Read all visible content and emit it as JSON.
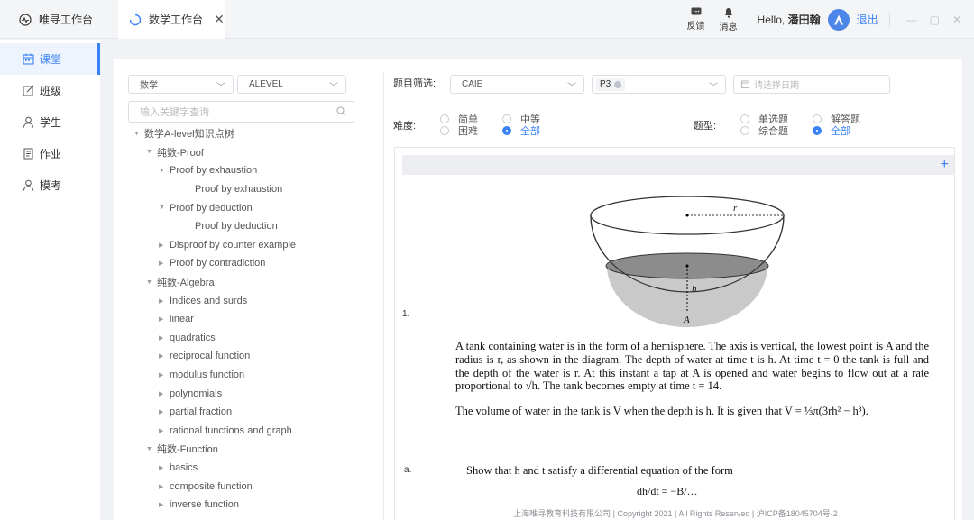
{
  "topbar": {
    "home_tab": "唯寻工作台",
    "active_tab": "数学工作台",
    "close_glyph": "✕",
    "feedback": "反馈",
    "messages": "消息",
    "hello": "Hello, ",
    "username": "潘田翰",
    "logout": "退出",
    "win_minimize": "—",
    "win_maximize": "▢",
    "win_close": "✕"
  },
  "sidebar": {
    "items": [
      {
        "label": "课堂",
        "icon": "calendar-icon",
        "active": true
      },
      {
        "label": "班级",
        "icon": "edit-icon",
        "active": false
      },
      {
        "label": "学生",
        "icon": "user-icon",
        "active": false
      },
      {
        "label": "作业",
        "icon": "document-icon",
        "active": false
      },
      {
        "label": "模考",
        "icon": "user-icon",
        "active": false
      }
    ]
  },
  "left_panel": {
    "subject_select": "数学",
    "level_select": "ALEVEL",
    "search_placeholder": "输入关键字查询",
    "tree": [
      {
        "label": "数学A-level知识点树",
        "level": 0,
        "expanded": true
      },
      {
        "label": "纯数-Proof",
        "level": 1,
        "expanded": true
      },
      {
        "label": "Proof by exhaustion",
        "level": 2,
        "expanded": true
      },
      {
        "label": "Proof by exhaustion",
        "level": 3,
        "expanded": null
      },
      {
        "label": "Proof by deduction",
        "level": 2,
        "expanded": true
      },
      {
        "label": "Proof by deduction",
        "level": 3,
        "expanded": null
      },
      {
        "label": "Disproof by counter example",
        "level": 2,
        "expanded": false
      },
      {
        "label": "Proof by contradiction",
        "level": 2,
        "expanded": false
      },
      {
        "label": "纯数-Algebra",
        "level": 1,
        "expanded": true
      },
      {
        "label": "Indices and surds",
        "level": 2,
        "expanded": false
      },
      {
        "label": "linear",
        "level": 2,
        "expanded": false
      },
      {
        "label": "quadratics",
        "level": 2,
        "expanded": false
      },
      {
        "label": "reciprocal function",
        "level": 2,
        "expanded": false
      },
      {
        "label": "modulus function",
        "level": 2,
        "expanded": false
      },
      {
        "label": "polynomials",
        "level": 2,
        "expanded": false
      },
      {
        "label": "partial fraction",
        "level": 2,
        "expanded": false
      },
      {
        "label": "rational functions and graph",
        "level": 2,
        "expanded": false
      },
      {
        "label": "纯数-Function",
        "level": 1,
        "expanded": true
      },
      {
        "label": "basics",
        "level": 2,
        "expanded": false
      },
      {
        "label": "composite function",
        "level": 2,
        "expanded": false
      },
      {
        "label": "inverse function",
        "level": 2,
        "expanded": false
      }
    ]
  },
  "filter": {
    "label": "题目筛选:",
    "board_select": "CAIE",
    "paper_chip": "P3",
    "date_placeholder": "请选择日期",
    "difficulty_label": "难度:",
    "difficulty_options": [
      {
        "label": "简单",
        "selected": false
      },
      {
        "label": "中等",
        "selected": false
      },
      {
        "label": "困难",
        "selected": false
      },
      {
        "label": "全部",
        "selected": true
      }
    ],
    "type_label": "题型:",
    "type_options": [
      {
        "label": "单选题",
        "selected": false
      },
      {
        "label": "解答题",
        "selected": false
      },
      {
        "label": "综合题",
        "selected": false
      },
      {
        "label": "全部",
        "selected": true
      }
    ]
  },
  "question": {
    "add_glyph": "+",
    "number": "1.",
    "diagram_labels": {
      "r": "r",
      "h": "h",
      "A": "A"
    },
    "para1": "A tank containing water is in the form of a hemisphere. The axis is vertical, the lowest point is A and the radius is r, as shown in the diagram. The depth of water at time t is h. At time t = 0 the tank is full and the depth of the water is r. At this instant a tap at A is opened and water begins to flow out at a rate proportional to √h. The tank becomes empty at time t = 14.",
    "para2": "The volume of water in the tank is V when the depth is h. It is given that V = ⅓π(3rh² − h³).",
    "part_label": "a.",
    "part_text": "Show that h and t satisfy a differential equation of the form",
    "equation": "dh/dt = −B/…",
    "footer": "上海唯寻教育科技有限公司 | Copyright 2021 | All Rights Reserved | 沪ICP备18045704号-2"
  },
  "colors": {
    "accent": "#3b82f6",
    "sidebar_active_bg": "#eef4fd",
    "water_fill": "#c9c9c9"
  }
}
